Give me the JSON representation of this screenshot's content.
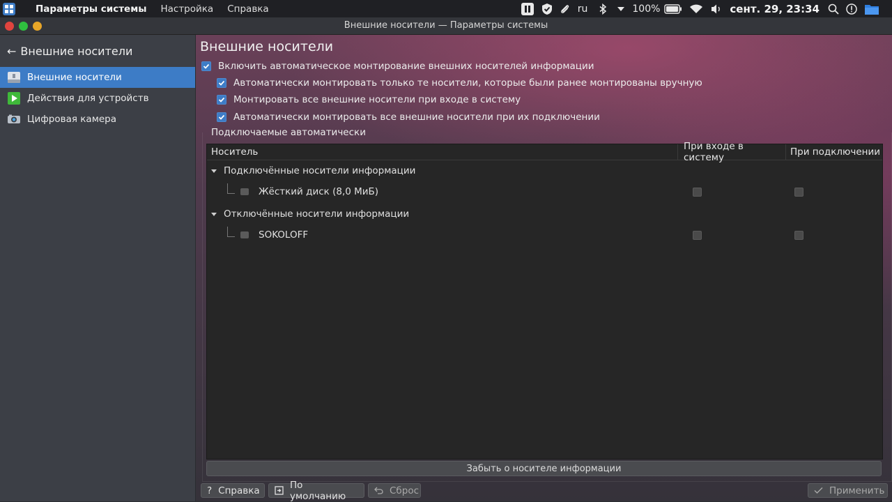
{
  "topbar": {
    "app_name": "Параметры системы",
    "menu": [
      "Настройка",
      "Справка"
    ],
    "keyboard_layout": "ru",
    "battery": "100%",
    "clock": "сент. 29, 23:34"
  },
  "window": {
    "title": "Внешние носители — Параметры системы"
  },
  "sidebar": {
    "back_label": "Внешние носители",
    "items": [
      {
        "label": "Внешние носители",
        "icon": "usb-drive-icon",
        "active": true
      },
      {
        "label": "Действия для устройств",
        "icon": "play-icon",
        "active": false
      },
      {
        "label": "Цифровая камера",
        "icon": "camera-icon",
        "active": false
      }
    ]
  },
  "main": {
    "title": "Внешние носители",
    "options": [
      {
        "label": "Включить автоматическое монтирование внешних носителей информации",
        "checked": true
      },
      {
        "label": "Автоматически монтировать только те носители, которые были ранее монтированы вручную",
        "checked": true
      },
      {
        "label": "Монтировать все внешние носители при входе в систему",
        "checked": true
      },
      {
        "label": "Автоматически монтировать все внешние носители при их подключении",
        "checked": true
      }
    ],
    "group_label": "Подключаемые автоматически",
    "columns": [
      "Носитель",
      "При входе в систему",
      "При подключении"
    ],
    "tree": [
      {
        "group": "Подключённые носители информации",
        "items": [
          {
            "label": "Жёсткий диск (8,0 МиБ)",
            "login": false,
            "attach": false
          }
        ]
      },
      {
        "group": "Отключённые носители информации",
        "items": [
          {
            "label": "SOKOLOFF",
            "login": false,
            "attach": false
          }
        ]
      }
    ],
    "forget_button": "Забыть о носителе информации"
  },
  "buttons": {
    "help": "Справка",
    "defaults": "По умолчанию",
    "reset": "Сброс",
    "apply": "Применить"
  },
  "colors": {
    "accent": "#3d7cc6",
    "close": "#e0443e",
    "minimize": "#2fbf3f",
    "maximize": "#e8a628"
  }
}
